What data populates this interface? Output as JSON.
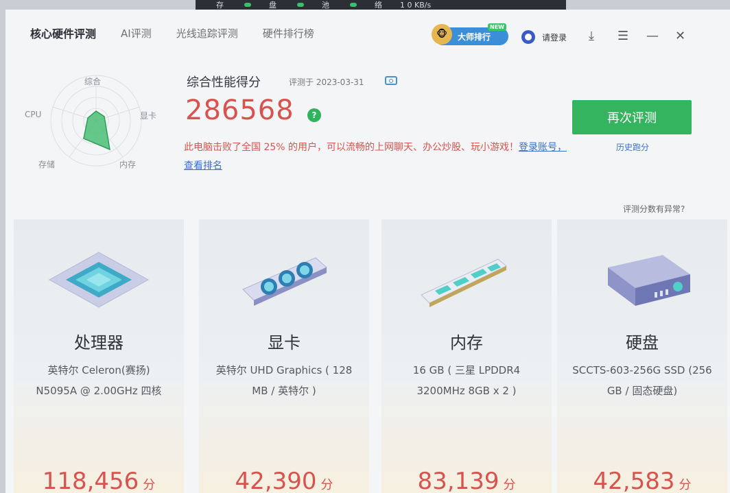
{
  "status_bar": {
    "item1": "存",
    "item2": "盘",
    "item3": "池",
    "net_label": "络",
    "net_speed": "1 0 KB/s"
  },
  "tabs": [
    "核心硬件评测",
    "AI评测",
    "光线追踪评测",
    "硬件排行榜"
  ],
  "rank_button": {
    "label": "大师排行",
    "badge": "NEW"
  },
  "login": {
    "label": "请登录"
  },
  "radar": {
    "labels": {
      "top": "综合",
      "right": "显卡",
      "bottom_right": "内存",
      "bottom_left": "存储",
      "left": "CPU"
    }
  },
  "summary": {
    "title": "综合性能得分",
    "date": "评测于 2023-03-31",
    "score": "286568",
    "help": "?",
    "description": "此电脑击败了全国 25% 的用户，可以流畅的上网聊天、办公炒股、玩小游戏！",
    "link": "登录账号，查看排名"
  },
  "actions": {
    "retest": "再次评测",
    "history": "历史跑分",
    "anomaly": "评测分数有异常?"
  },
  "cards": [
    {
      "name": "处理器",
      "detail": "英特尔 Celeron(赛扬) N5095A @ 2.00GHz 四核",
      "score": "118,456",
      "unit": "分"
    },
    {
      "name": "显卡",
      "detail": "英特尔 UHD Graphics ( 128 MB / 英特尔 )",
      "score": "42,390",
      "unit": "分"
    },
    {
      "name": "内存",
      "detail": "16 GB ( 三星 LPDDR4 3200MHz 8GB x 2 )",
      "score": "83,139",
      "unit": "分"
    },
    {
      "name": "硬盘",
      "detail": "SCCTS-603-256G SSD (256 GB / 固态硬盘)",
      "score": "42,583",
      "unit": "分"
    }
  ],
  "colors": {
    "accent_green": "#35b45f",
    "score_red": "#d8524e",
    "link_blue": "#3a6fd0"
  }
}
